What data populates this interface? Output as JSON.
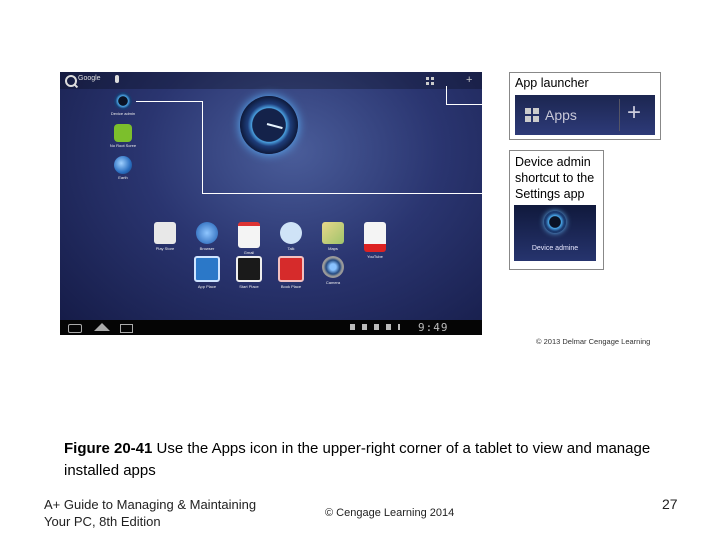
{
  "tablet": {
    "search_label": "Google",
    "apps_label": "Apps",
    "clock_time": "9:49",
    "shortcuts": [
      {
        "label": "Device admin"
      },
      {
        "label": "No Root Scree"
      },
      {
        "label": "Earth"
      }
    ],
    "apps_row1": [
      {
        "label": "Play Store"
      },
      {
        "label": "Browser"
      },
      {
        "label": "Gmail"
      },
      {
        "label": "Talk"
      },
      {
        "label": "Maps"
      },
      {
        "label": "YouTube"
      }
    ],
    "apps_row2": [
      {
        "label": "App Place"
      },
      {
        "label": "Start Place"
      },
      {
        "label": "Book Place"
      },
      {
        "label": "Camera"
      }
    ]
  },
  "callouts": {
    "app_launcher_title": "App launcher",
    "app_launcher_zoom_label": "Apps",
    "device_admin_line1": "Device admin",
    "device_admin_line2": "shortcut to the",
    "device_admin_line3": "Settings app",
    "device_admin_zoom_label": "Device admine"
  },
  "credit": "© 2013 Delmar Cengage Learning",
  "caption": {
    "figure_label": "Figure 20-41",
    "text": " Use the Apps icon in the upper-right corner of a tablet to view and manage installed apps"
  },
  "footer": {
    "book_line1": "A+ Guide to Managing & Maintaining",
    "book_line2": "Your PC, 8th Edition",
    "copyright": "© Cengage Learning 2014",
    "page_number": "27"
  }
}
